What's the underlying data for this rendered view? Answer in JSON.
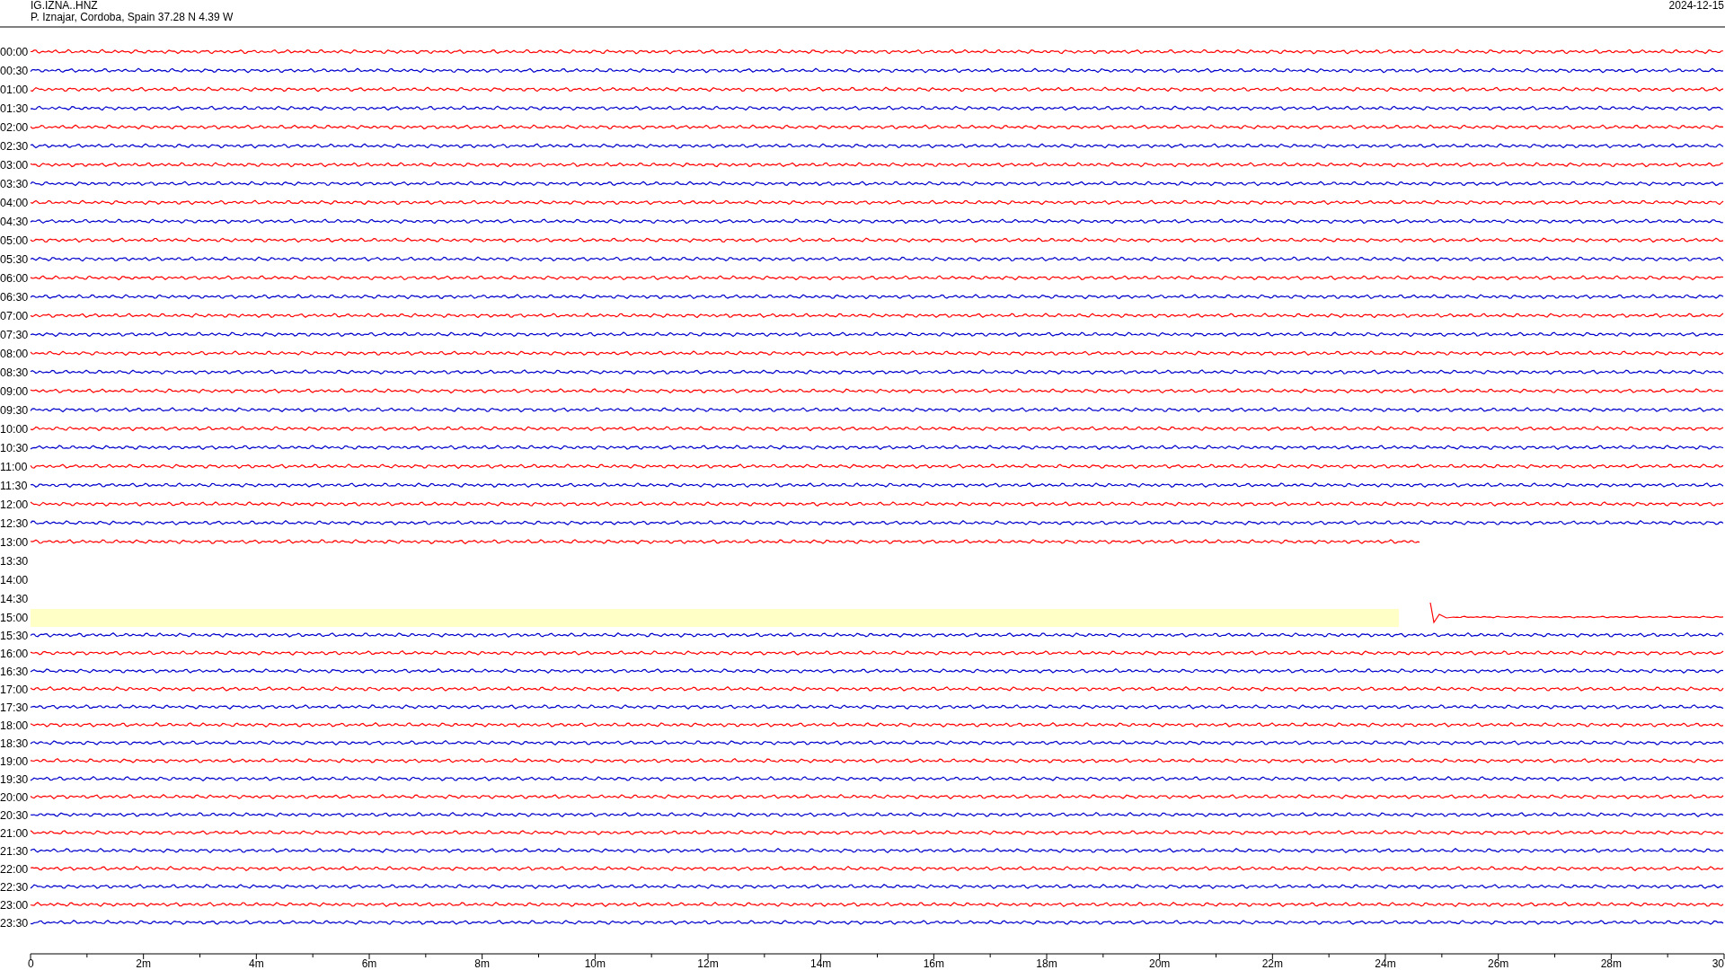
{
  "header": {
    "station": "IG.IZNA..HNZ",
    "location": "P. Iznajar, Cordoba, Spain  37.28 N 4.39 W",
    "date": "2024-12-15"
  },
  "rows": [
    {
      "label": "00:00",
      "color": "#ff0000",
      "kind": "full"
    },
    {
      "label": "00:30",
      "color": "#0000cc",
      "kind": "full"
    },
    {
      "label": "01:00",
      "color": "#ff0000",
      "kind": "full"
    },
    {
      "label": "01:30",
      "color": "#0000cc",
      "kind": "full"
    },
    {
      "label": "02:00",
      "color": "#ff0000",
      "kind": "full"
    },
    {
      "label": "02:30",
      "color": "#0000cc",
      "kind": "full"
    },
    {
      "label": "03:00",
      "color": "#ff0000",
      "kind": "full"
    },
    {
      "label": "03:30",
      "color": "#0000cc",
      "kind": "full"
    },
    {
      "label": "04:00",
      "color": "#ff0000",
      "kind": "full"
    },
    {
      "label": "04:30",
      "color": "#0000cc",
      "kind": "full"
    },
    {
      "label": "05:00",
      "color": "#ff0000",
      "kind": "full"
    },
    {
      "label": "05:30",
      "color": "#0000cc",
      "kind": "full"
    },
    {
      "label": "06:00",
      "color": "#ff0000",
      "kind": "full"
    },
    {
      "label": "06:30",
      "color": "#0000cc",
      "kind": "full"
    },
    {
      "label": "07:00",
      "color": "#ff0000",
      "kind": "full"
    },
    {
      "label": "07:30",
      "color": "#0000cc",
      "kind": "full"
    },
    {
      "label": "08:00",
      "color": "#ff0000",
      "kind": "full"
    },
    {
      "label": "08:30",
      "color": "#0000cc",
      "kind": "full"
    },
    {
      "label": "09:00",
      "color": "#ff0000",
      "kind": "full"
    },
    {
      "label": "09:30",
      "color": "#0000cc",
      "kind": "full"
    },
    {
      "label": "10:00",
      "color": "#ff0000",
      "kind": "full"
    },
    {
      "label": "10:30",
      "color": "#0000cc",
      "kind": "full"
    },
    {
      "label": "11:00",
      "color": "#ff0000",
      "kind": "full"
    },
    {
      "label": "11:30",
      "color": "#0000cc",
      "kind": "full"
    },
    {
      "label": "12:00",
      "color": "#ff0000",
      "kind": "full"
    },
    {
      "label": "12:30",
      "color": "#0000cc",
      "kind": "full"
    },
    {
      "label": "13:00",
      "color": "#ff0000",
      "kind": "ends_early"
    },
    {
      "label": "13:30",
      "kind": "none"
    },
    {
      "label": "14:00",
      "kind": "none"
    },
    {
      "label": "14:30",
      "kind": "none"
    },
    {
      "label": "15:00",
      "color": "#ff0000",
      "kind": "gap_then_trace"
    },
    {
      "label": "15:30",
      "color": "#0000cc",
      "kind": "full"
    },
    {
      "label": "16:00",
      "color": "#ff0000",
      "kind": "full"
    },
    {
      "label": "16:30",
      "color": "#0000cc",
      "kind": "full"
    },
    {
      "label": "17:00",
      "color": "#ff0000",
      "kind": "full"
    },
    {
      "label": "17:30",
      "color": "#0000cc",
      "kind": "full"
    },
    {
      "label": "18:00",
      "color": "#ff0000",
      "kind": "full"
    },
    {
      "label": "18:30",
      "color": "#0000cc",
      "kind": "full"
    },
    {
      "label": "19:00",
      "color": "#ff0000",
      "kind": "full"
    },
    {
      "label": "19:30",
      "color": "#0000cc",
      "kind": "full"
    },
    {
      "label": "20:00",
      "color": "#ff0000",
      "kind": "full"
    },
    {
      "label": "20:30",
      "color": "#0000cc",
      "kind": "full"
    },
    {
      "label": "21:00",
      "color": "#ff0000",
      "kind": "full"
    },
    {
      "label": "21:30",
      "color": "#0000cc",
      "kind": "full"
    },
    {
      "label": "22:00",
      "color": "#ff0000",
      "kind": "full"
    },
    {
      "label": "22:30",
      "color": "#0000cc",
      "kind": "full"
    },
    {
      "label": "23:00",
      "color": "#ff0000",
      "kind": "full"
    },
    {
      "label": "23:30",
      "color": "#0000cc",
      "kind": "full"
    }
  ],
  "x_axis": {
    "ticks": [
      "0",
      "2m",
      "4m",
      "6m",
      "8m",
      "10m",
      "12m",
      "14m",
      "16m",
      "18m",
      "20m",
      "22m",
      "24m",
      "26m",
      "28m",
      "30"
    ]
  }
}
